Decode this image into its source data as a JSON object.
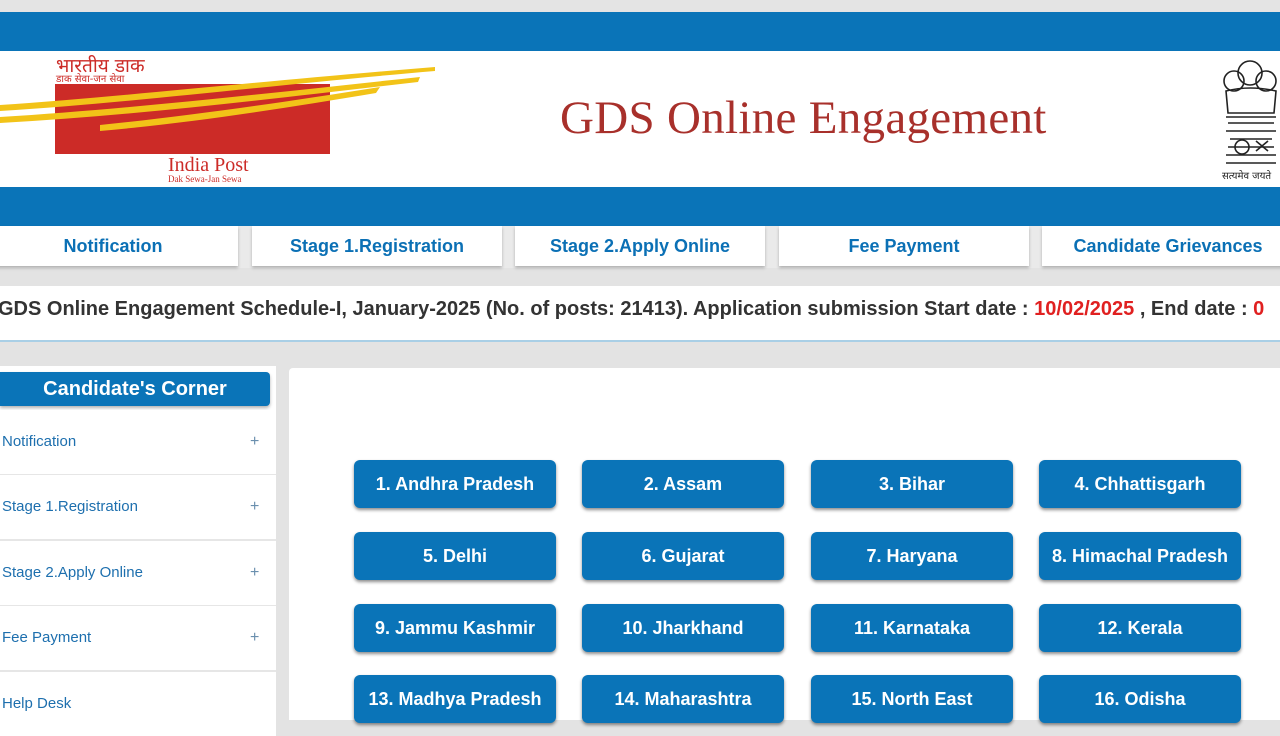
{
  "header": {
    "title": "GDS Online Engagement",
    "logo_hindi_top": "भारतीय डाक",
    "logo_hindi_sub": "डाक सेवा-जन सेवा",
    "logo_brand": "India Post",
    "logo_tagline": "Dak Sewa-Jan Sewa",
    "emblem_motto": "सत्यमेव जयते"
  },
  "nav": {
    "tabs": [
      {
        "label": "Notification"
      },
      {
        "label": "Stage 1.Registration"
      },
      {
        "label": "Stage 2.Apply Online"
      },
      {
        "label": "Fee Payment"
      },
      {
        "label": "Candidate Grievances"
      }
    ]
  },
  "ticker": {
    "text": "GDS Online Engagement Schedule-I, January-2025 (No. of posts: 21413). Application submission Start date : ",
    "start_date": "10/02/2025",
    "mid": " , End date : ",
    "end_date_partial": "0"
  },
  "sidebar": {
    "title": "Candidate's Corner",
    "items": [
      {
        "label": "Notification",
        "icon": "+"
      },
      {
        "label": "Stage 1.Registration",
        "icon": "+"
      },
      {
        "label": "Stage 2.Apply Online",
        "icon": "+"
      },
      {
        "label": "Fee Payment",
        "icon": "+"
      },
      {
        "label": "Help Desk"
      }
    ]
  },
  "states": [
    "1. Andhra Pradesh",
    "2. Assam",
    "3. Bihar",
    "4. Chhattisgarh",
    "5. Delhi",
    "6. Gujarat",
    "7. Haryana",
    "8. Himachal Pradesh",
    "9. Jammu Kashmir",
    "10. Jharkhand",
    "11. Karnataka",
    "12. Kerala",
    "13. Madhya Pradesh",
    "14. Maharashtra",
    "15. North East",
    "16. Odisha"
  ],
  "colors": {
    "primary_blue": "#0a74b8",
    "title_red": "#a8302b",
    "logo_red": "#cc2b27",
    "logo_yellow": "#f2c318",
    "date_red": "#e02020"
  }
}
